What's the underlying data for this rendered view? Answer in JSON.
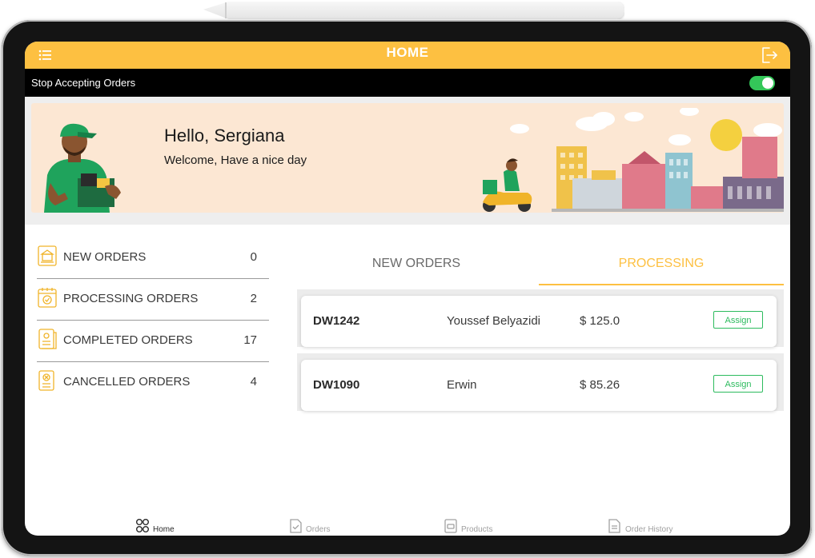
{
  "header": {
    "title": "HOME",
    "menu_icon": "list-icon",
    "logout_icon": "logout-icon",
    "bar_color": "#fdc041"
  },
  "status_bar": {
    "label": "Stop Accepting Orders",
    "toggle_on": true,
    "toggle_color": "#34c759"
  },
  "banner": {
    "greeting": "Hello, Sergiana",
    "message": "Welcome, Have a nice day",
    "background": "#fce7d3"
  },
  "summary": [
    {
      "label": "NEW ORDERS",
      "count": "0",
      "icon": "new-orders-icon"
    },
    {
      "label": "PROCESSING ORDERS",
      "count": "2",
      "icon": "processing-orders-icon"
    },
    {
      "label": "COMPLETED ORDERS",
      "count": "17",
      "icon": "completed-orders-icon"
    },
    {
      "label": "CANCELLED ORDERS",
      "count": "4",
      "icon": "cancelled-orders-icon"
    }
  ],
  "tabs": [
    {
      "label": "NEW ORDERS",
      "active": false
    },
    {
      "label": "PROCESSING",
      "active": true
    }
  ],
  "orders": [
    {
      "id": "DW1242",
      "customer": "Youssef Belyazidi",
      "amount": "$ 125.0",
      "action": "Assign"
    },
    {
      "id": "DW1090",
      "customer": "Erwin",
      "amount": "$ 85.26",
      "action": "Assign"
    }
  ],
  "bottom_nav": [
    {
      "label": "Home",
      "icon": "grid-icon",
      "active": true
    },
    {
      "label": "Orders",
      "icon": "orders-icon",
      "active": false
    },
    {
      "label": "Products",
      "icon": "products-icon",
      "active": false
    },
    {
      "label": "Order History",
      "icon": "history-icon",
      "active": false
    }
  ],
  "accent_color": "#fdc041",
  "assign_color": "#2dbb5e"
}
